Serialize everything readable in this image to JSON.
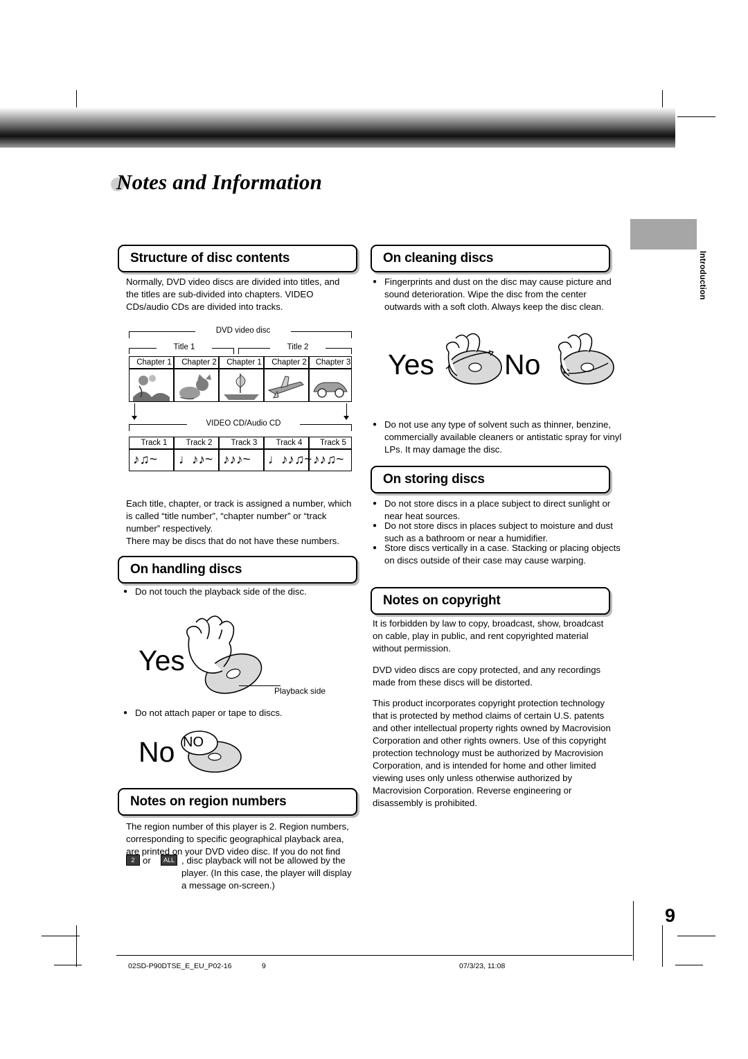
{
  "document": {
    "title": "Notes and Information",
    "side_tab": "Introduction",
    "page_number": "9"
  },
  "sections": {
    "structure": {
      "heading": "Structure of disc contents",
      "paragraph": "Normally, DVD video discs are divided into titles, and the titles are sub-divided into chapters. VIDEO CDs/audio CDs are divided into tracks.",
      "diagram": {
        "dvd_label": "DVD video disc",
        "titles": [
          "Title 1",
          "Title 2"
        ],
        "chapters": [
          "Chapter 1",
          "Chapter 2",
          "Chapter 1",
          "Chapter 2",
          "Chapter 3"
        ],
        "cd_label": "VIDEO CD/Audio CD",
        "tracks": [
          "Track 1",
          "Track 2",
          "Track 3",
          "Track 4",
          "Track 5"
        ]
      },
      "paragraph2": "Each title, chapter, or track is assigned a number, which is called “title number”, “chapter number” or “track number” respectively.",
      "paragraph3": "There may be discs that do not have these numbers."
    },
    "handling": {
      "heading": "On handling discs",
      "bullet1": "Do not touch the playback side of the disc.",
      "yes_label": "Yes",
      "playback_side_label": "Playback side",
      "bullet2": "Do not attach paper or tape to discs.",
      "no_label": "No",
      "no_badge": "NO"
    },
    "region": {
      "heading": "Notes on region numbers",
      "text_before": "The region number of this player is 2. Region numbers, corresponding to specific geographical playback area, are printed on your DVD video disc. If you do not find",
      "icon1": "2",
      "or": "or",
      "icon2": "ALL",
      "text_after": ", disc playback will not be allowed by the player. (In this case, the player will display a message on-screen.)"
    },
    "cleaning": {
      "heading": "On cleaning discs",
      "bullet1": "Fingerprints and dust on the disc may cause picture and sound deterioration. Wipe the disc from the center outwards with a soft cloth. Always keep the disc clean.",
      "yes_label": "Yes",
      "no_label": "No",
      "bullet2": "Do not use any type of solvent such as thinner, benzine, commercially available cleaners or antistatic spray for vinyl LPs. It may damage the disc."
    },
    "storing": {
      "heading": "On storing discs",
      "bullets": [
        "Do not store discs in a place subject to direct sunlight or near heat sources.",
        "Do not store discs in places subject to moisture and dust such as a bathroom or near a humidifier.",
        "Store discs vertically in a case. Stacking or placing objects on discs outside of their case may cause warping."
      ]
    },
    "copyright": {
      "heading": "Notes on copyright",
      "paragraph1": "It is forbidden by law to copy, broadcast, show, broadcast on cable, play in public, and rent copyrighted material without permission.",
      "paragraph2": "DVD video discs are copy protected, and any recordings made from these discs will be distorted.",
      "paragraph3": "This product incorporates copyright protection technology that is protected by method claims of certain U.S. patents and other intellectual property rights owned by Macrovision Corporation and other rights owners. Use of this copyright protection technology must be authorized by Macrovision Corporation, and is intended for home and other limited viewing uses only unless otherwise authorized by Macrovision Corporation. Reverse engineering or disassembly is prohibited."
    }
  },
  "footer": {
    "file": "02SD-P90DTSE_E_EU_P02-16",
    "page": "9",
    "date": "07/3/23, 11:08"
  }
}
